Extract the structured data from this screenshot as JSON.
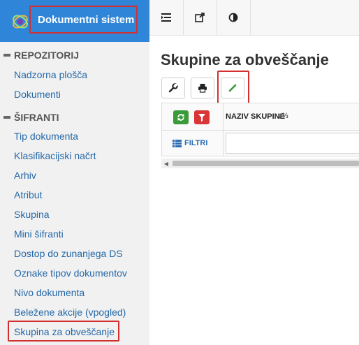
{
  "app": {
    "title": "Dokumentni sistem"
  },
  "sidebar": {
    "sections": [
      {
        "label": "REPOZITORIJ",
        "items": [
          "Nadzorna plošča",
          "Dokumenti"
        ]
      },
      {
        "label": "ŠIFRANTI",
        "items": [
          "Tip dokumenta",
          "Klasifikacijski načrt",
          "Arhiv",
          "Atribut",
          "Skupina",
          "Mini šifranti",
          "Dostop do zunanjega DS",
          "Oznake tipov dokumentov",
          "Nivo dokumenta",
          "Beležene akcije (vpogled)",
          "Skupina za obveščanje"
        ]
      }
    ]
  },
  "page": {
    "title": "Skupine za obveščanje"
  },
  "grid": {
    "column_header": "NAZIV SKUPINE",
    "filter_label": "FILTRI"
  },
  "colors": {
    "brand": "#2f86d8",
    "link": "#2468a8",
    "highlight": "#d32f2f",
    "refresh": "#3a9b3a",
    "filter": "#d93737"
  },
  "icons": {
    "top": [
      "menu-toggle-icon",
      "external-link-icon",
      "contrast-icon"
    ],
    "toolbar": [
      "wrench-icon",
      "print-icon",
      "pencil-icon"
    ]
  }
}
